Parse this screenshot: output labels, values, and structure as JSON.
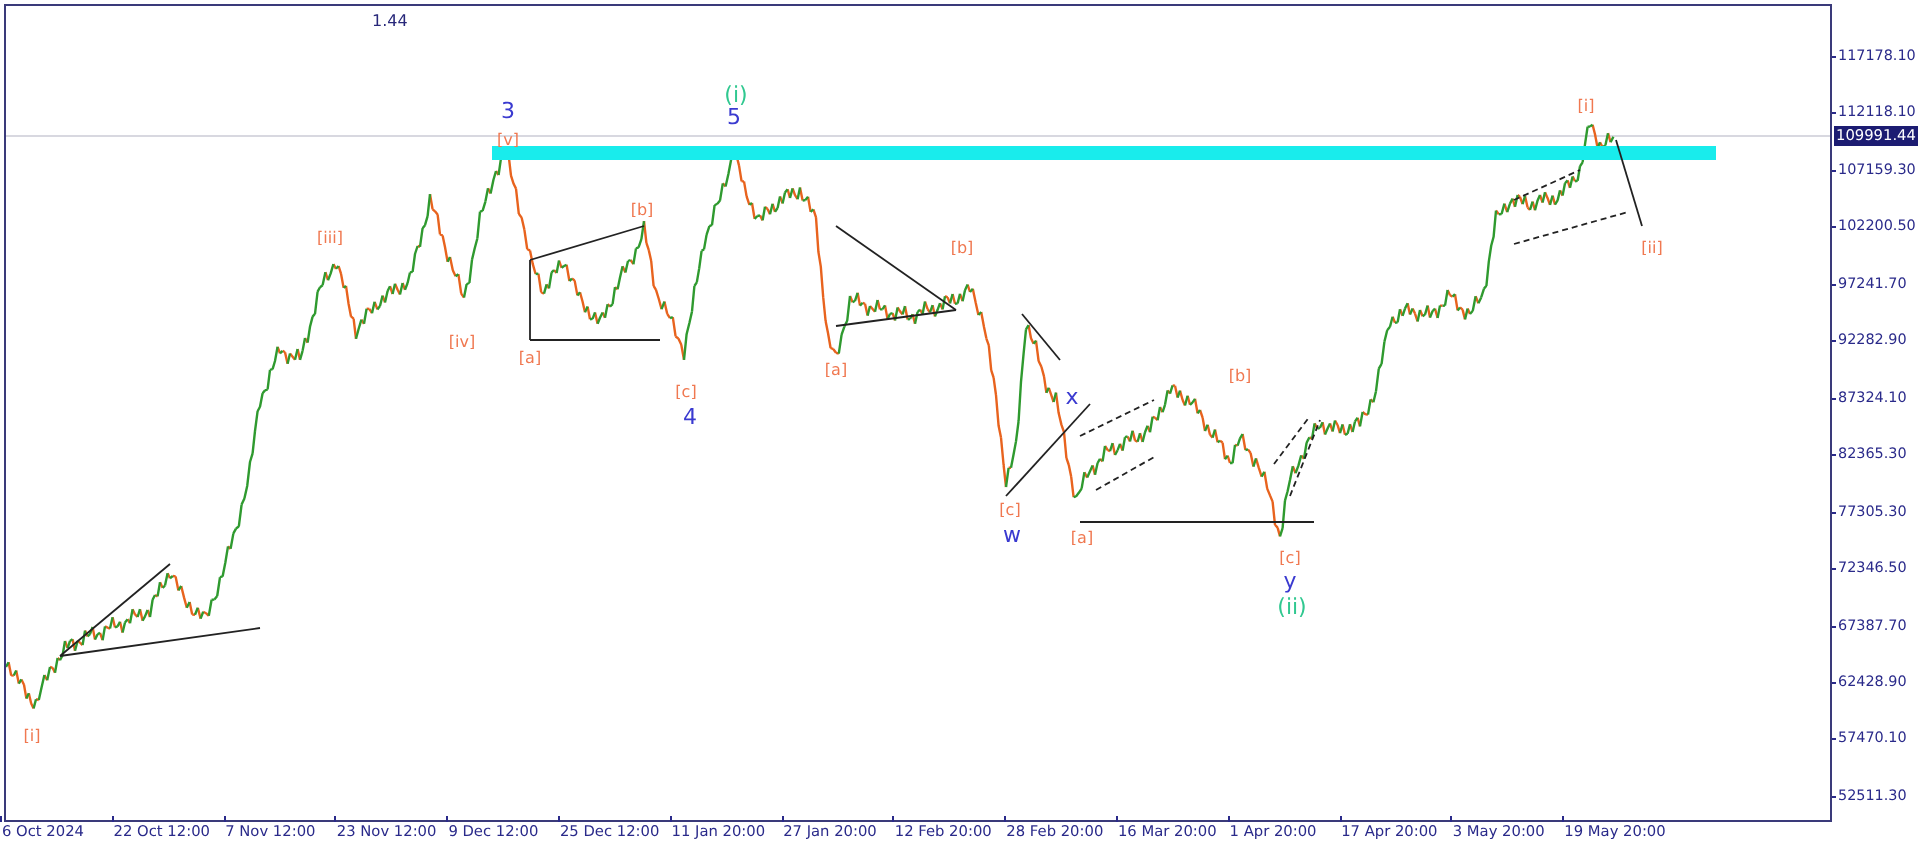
{
  "title_fragment": "1.44",
  "wave_labels": [
    {
      "text": "[i]",
      "color": "#f07850"
    },
    {
      "text": "[iii]",
      "color": "#f07850"
    },
    {
      "text": "[iv]",
      "color": "#f07850"
    },
    {
      "text": "3",
      "color": "#3a3ad0"
    },
    {
      "text": "[v]",
      "color": "#f07850"
    },
    {
      "text": "[a]",
      "color": "#f07850"
    },
    {
      "text": "[b]",
      "color": "#f07850"
    },
    {
      "text": "[c]",
      "color": "#f07850"
    },
    {
      "text": "4",
      "color": "#3a3ad0"
    },
    {
      "text": "(i)",
      "color": "#30c890"
    },
    {
      "text": "5",
      "color": "#3a3ad0"
    },
    {
      "text": "[a]",
      "color": "#f07850"
    },
    {
      "text": "[b]",
      "color": "#f07850"
    },
    {
      "text": "[c]",
      "color": "#f07850"
    },
    {
      "text": "w",
      "color": "#3a3ad0"
    },
    {
      "text": "x",
      "color": "#3a3ad0"
    },
    {
      "text": "[a]",
      "color": "#f07850"
    },
    {
      "text": "[b]",
      "color": "#f07850"
    },
    {
      "text": "[c]",
      "color": "#f07850"
    },
    {
      "text": "y",
      "color": "#3a3ad0"
    },
    {
      "text": "(ii)",
      "color": "#30c890"
    },
    {
      "text": "[i]",
      "color": "#f07850"
    },
    {
      "text": "[ii]",
      "color": "#f07850"
    }
  ],
  "price_axis": {
    "labels": [
      "117178.10",
      "112118.10",
      "107159.30",
      "102200.50",
      "97241.70",
      "92282.90",
      "87324.10",
      "82365.30",
      "77305.30",
      "72346.50",
      "67387.70",
      "62428.90",
      "57470.10",
      "52511.30"
    ],
    "current_price": "109991.44"
  },
  "time_axis": {
    "labels": [
      "6 Oct 2024",
      "22 Oct 12:00",
      "7 Nov 12:00",
      "23 Nov 12:00",
      "9 Dec 12:00",
      "25 Dec 12:00",
      "11 Jan 20:00",
      "27 Jan 20:00",
      "12 Feb 20:00",
      "28 Feb 20:00",
      "16 Mar 20:00",
      "1 Apr 20:00",
      "17 Apr 20:00",
      "3 May 20:00",
      "19 May 20:00"
    ]
  }
}
